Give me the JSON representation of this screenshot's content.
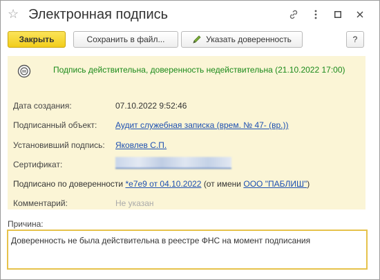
{
  "window": {
    "title": "Электронная подпись"
  },
  "toolbar": {
    "close_label": "Закрыть",
    "save_file_label": "Сохранить в файл...",
    "set_proxy_label": "Указать доверенность",
    "help_label": "?"
  },
  "status": {
    "text": "Подпись действительна, доверенность недействительна (21.10.2022 17:00)"
  },
  "fields": {
    "created_label": "Дата создания:",
    "created_value": "07.10.2022 9:52:46",
    "signed_object_label": "Подписанный объект:",
    "signed_object_value": "Аудит служебная записка (врем. № 47- (вр.))",
    "signer_label": "Установивший подпись:",
    "signer_value": "Яковлев С.П.",
    "certificate_label": "Сертификат:",
    "proxy_prefix": "Подписано по доверенности",
    "proxy_link": "*e7e9 от 04.10.2022",
    "proxy_middle": "(от имени",
    "proxy_org": "ООО \"ПАБЛИШ\"",
    "proxy_suffix": ")",
    "comment_label": "Комментарий:",
    "comment_value": "Не указан"
  },
  "reason": {
    "label": "Причина:",
    "value": "Доверенность не была действительна в реестре ФНС на момент подписания"
  },
  "colors": {
    "panel_bg": "#fbf5d6",
    "status_green": "#1a8a1a",
    "link_blue": "#1c4fb1",
    "primary_yellow": "#f2cd1b",
    "focus_border": "#e6c24a"
  }
}
